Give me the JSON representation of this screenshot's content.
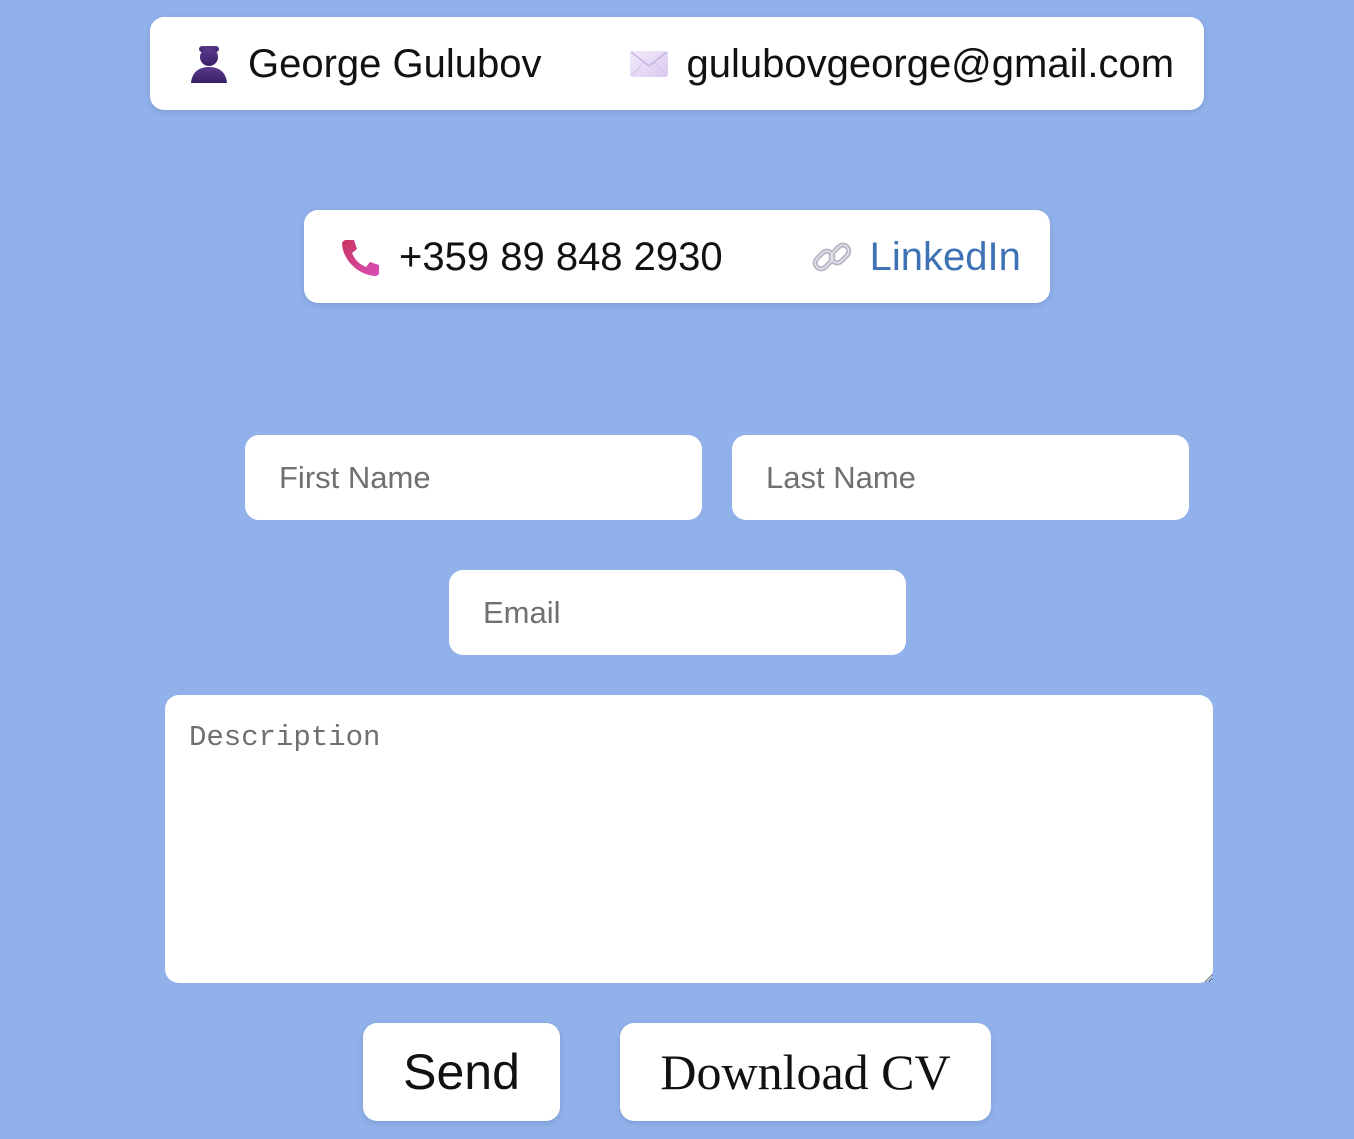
{
  "contact": {
    "name": "George Gulubov",
    "email": "gulubovgeorge@gmail.com",
    "phone": "+359 89 848 2930",
    "linkedin_label": "LinkedIn",
    "icons": {
      "name": "person-silhouette-icon",
      "email": "envelope-icon",
      "phone": "telephone-receiver-icon",
      "linkedin": "link-chain-icon"
    }
  },
  "form": {
    "first_name_placeholder": "First Name",
    "last_name_placeholder": "Last Name",
    "email_placeholder": "Email",
    "description_placeholder": "Description"
  },
  "buttons": {
    "send_label": "Send",
    "download_cv_label": "Download CV"
  },
  "colors": {
    "background": "#91b1ea",
    "card": "#ffffff",
    "link": "#3e72b5"
  }
}
